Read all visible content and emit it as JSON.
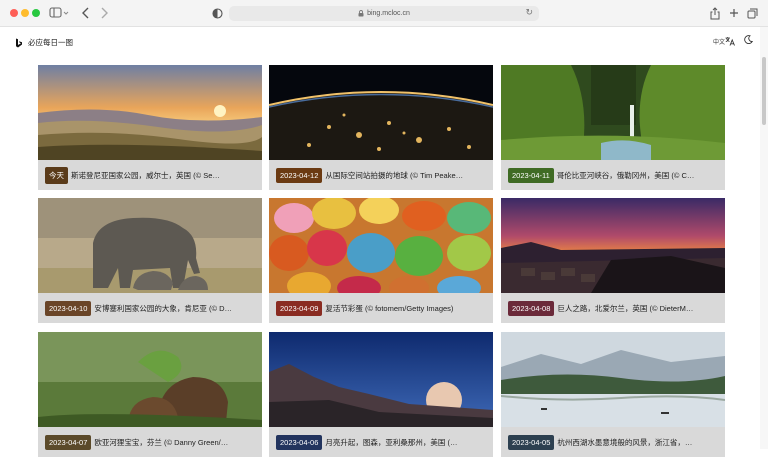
{
  "browser": {
    "url": "bing.mcloc.cn"
  },
  "site": {
    "title": "必应每日一图",
    "lang_label": "中文"
  },
  "cards": [
    {
      "date": "今天",
      "caption": "斯诺登尼亚国家公园，威尔士，英国 (© Sebast…",
      "badge_color": "#5a3b1a"
    },
    {
      "date": "2023-04-12",
      "caption": "从国际空间站拍摄的地球 (© Tim Peake…",
      "badge_color": "#6b3a12"
    },
    {
      "date": "2023-04-11",
      "caption": "哥伦比亚河峡谷，俄勒冈州，美国 (© C…",
      "badge_color": "#3f6b24"
    },
    {
      "date": "2023-04-10",
      "caption": "安博塞利国家公园的大象，肯尼亚 (© D…",
      "badge_color": "#6a4528"
    },
    {
      "date": "2023-04-09",
      "caption": "复活节彩蛋 (© fotomem/Getty Images)",
      "badge_color": "#8a2c22"
    },
    {
      "date": "2023-04-08",
      "caption": "巨人之路，北爱尔兰，英国 (© DieterM…",
      "badge_color": "#6b2a3a"
    },
    {
      "date": "2023-04-07",
      "caption": "欧亚河狸宝宝，芬兰 (© Danny Green/…",
      "badge_color": "#5b4a2a"
    },
    {
      "date": "2023-04-06",
      "caption": "月亮升起，图森，亚利桑那州，美国 (…",
      "badge_color": "#22345e"
    },
    {
      "date": "2023-04-05",
      "caption": "杭州西湖水墨意境般的风景，浙江省，…",
      "badge_color": "#2d4050"
    }
  ]
}
